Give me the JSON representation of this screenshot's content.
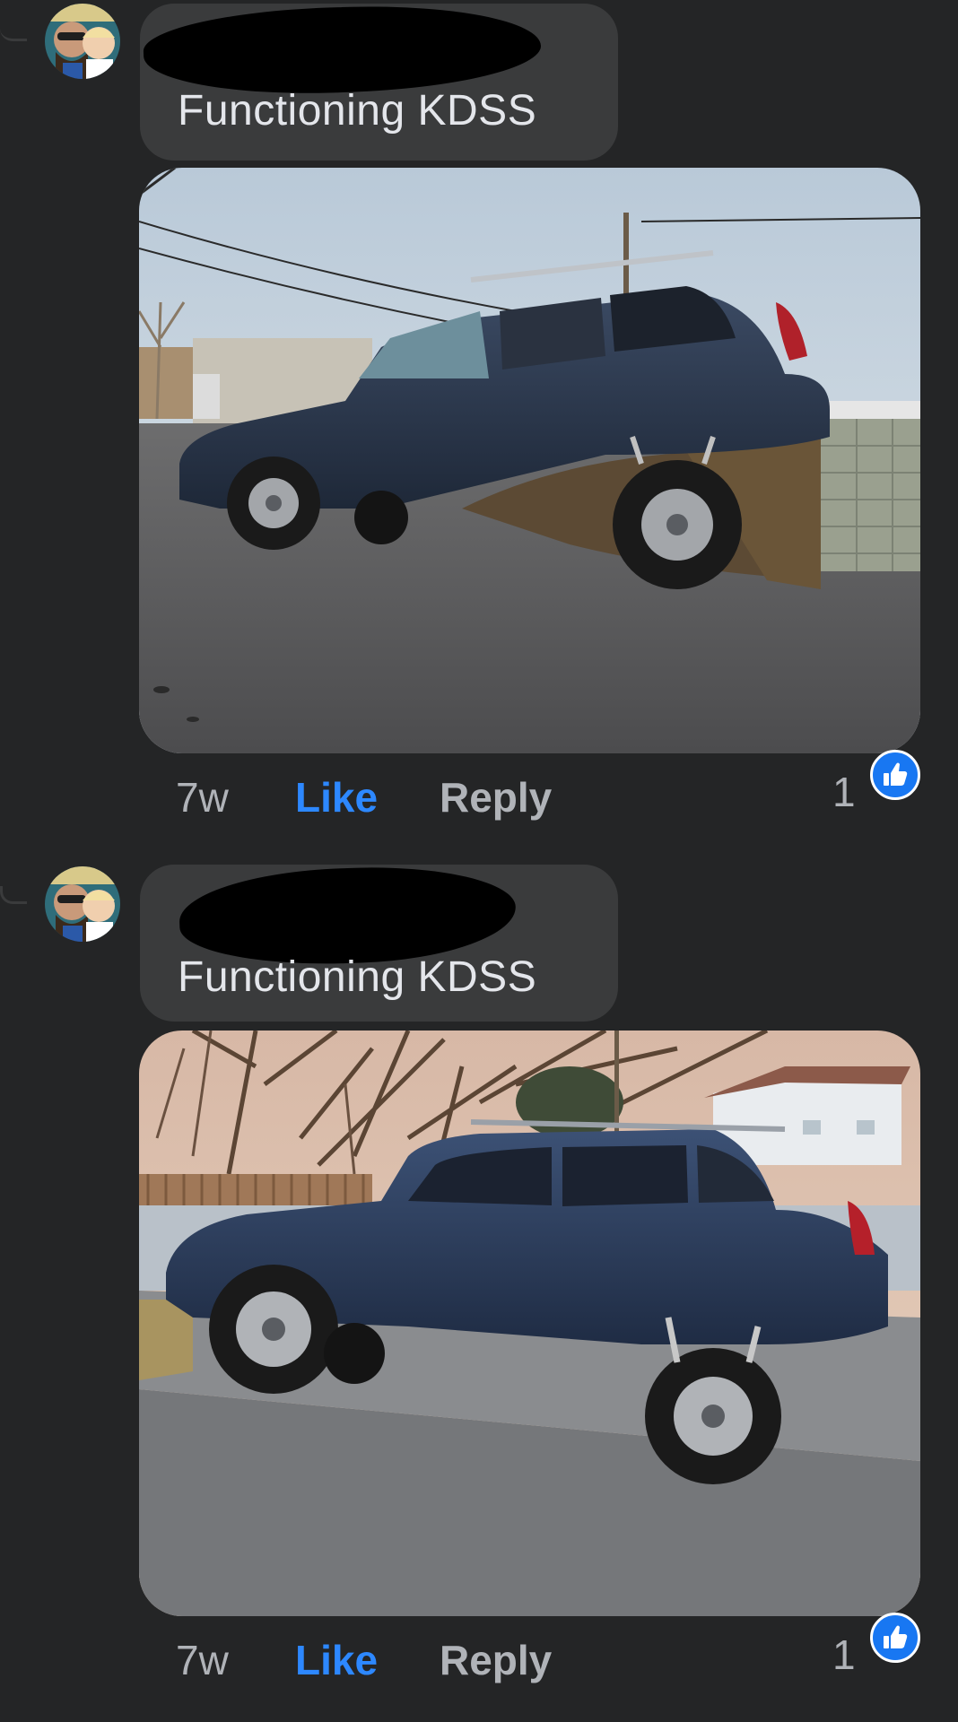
{
  "comments": [
    {
      "author_redacted": true,
      "text": "Functioning KDSS",
      "time": "7w",
      "like_label": "Like",
      "reply_label": "Reply",
      "reaction_count": "1",
      "reaction_icon": "thumbs-up-icon"
    },
    {
      "author_redacted": true,
      "text": "Functioning KDSS",
      "time": "7w",
      "like_label": "Like",
      "reply_label": "Reply",
      "reaction_count": "1",
      "reaction_icon": "thumbs-up-icon"
    }
  ],
  "colors": {
    "background": "#242526",
    "bubble": "#3a3b3c",
    "text": "#e4e6eb",
    "secondary_text": "#b0b3b8",
    "like_blue": "#2d88ff",
    "reaction_blue": "#1877f2"
  }
}
